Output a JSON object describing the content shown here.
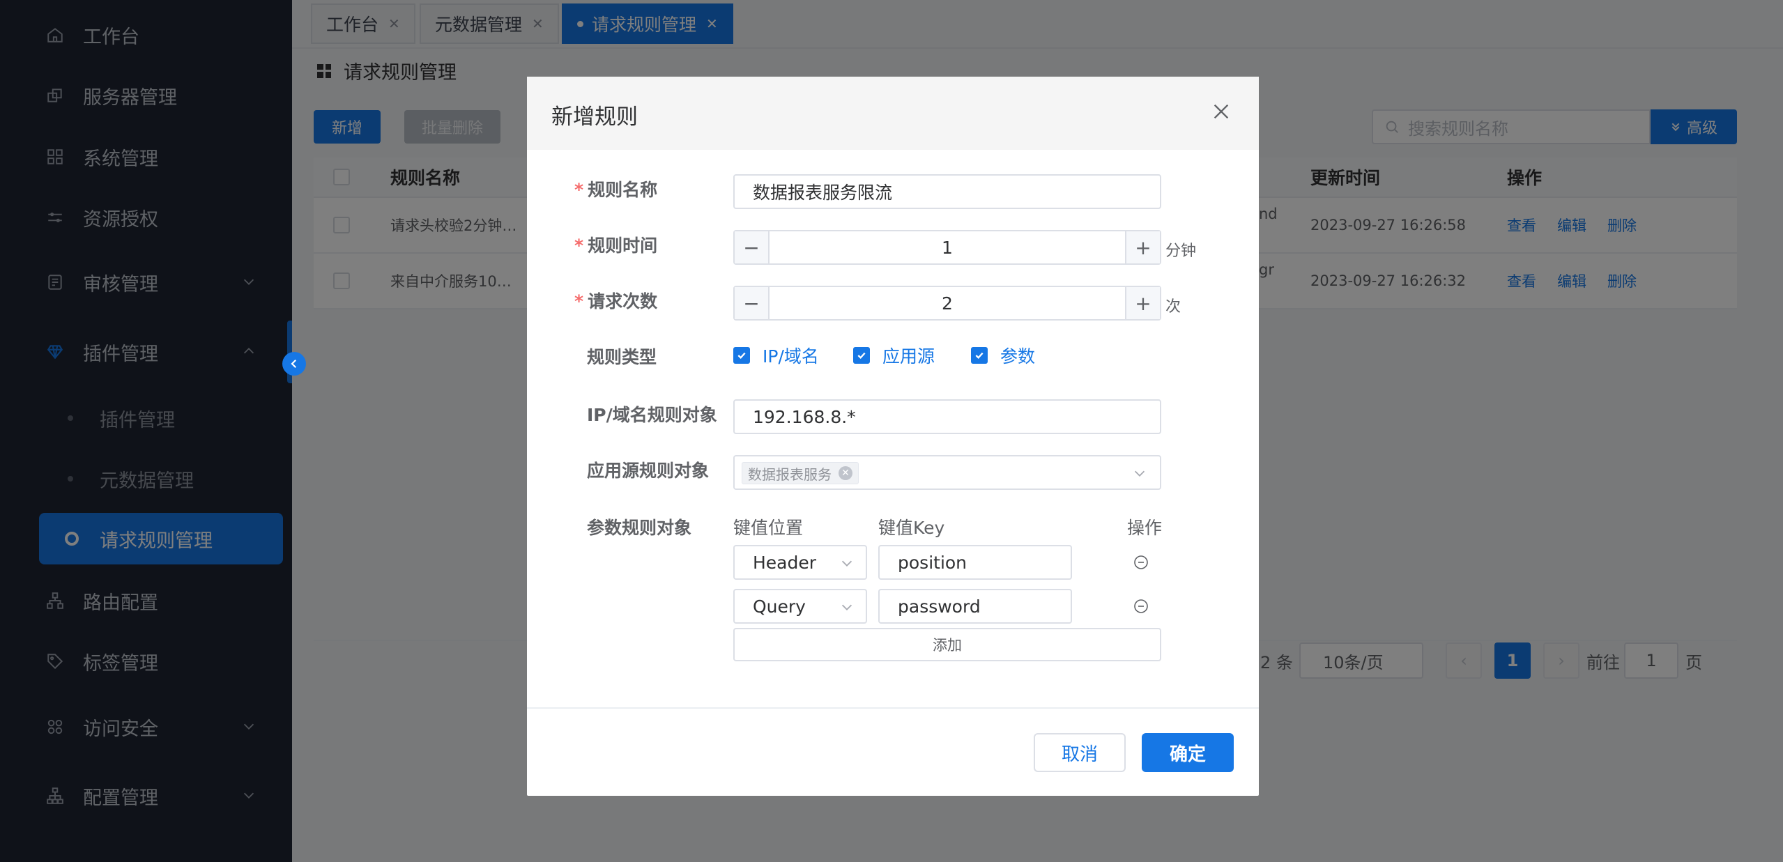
{
  "sidebar": {
    "items": [
      {
        "label": "工作台",
        "icon": "home-icon"
      },
      {
        "label": "服务器管理",
        "icon": "server-icon"
      },
      {
        "label": "系统管理",
        "icon": "grid-icon"
      },
      {
        "label": "资源授权",
        "icon": "sliders-icon"
      },
      {
        "label": "审核管理",
        "icon": "audit-icon"
      },
      {
        "label": "插件管理",
        "icon": "gem-icon"
      },
      {
        "label": "插件管理"
      },
      {
        "label": "元数据管理"
      },
      {
        "label": "请求规则管理"
      },
      {
        "label": "路由配置",
        "icon": "route-icon"
      },
      {
        "label": "标签管理",
        "icon": "tag-icon"
      },
      {
        "label": "访问安全",
        "icon": "security-icon"
      },
      {
        "label": "配置管理",
        "icon": "config-icon"
      }
    ]
  },
  "tabs": [
    {
      "label": "工作台"
    },
    {
      "label": "元数据管理"
    },
    {
      "label": "请求规则管理"
    }
  ],
  "page": {
    "title": "请求规则管理",
    "add_label": "新增",
    "batch_delete_label": "批量删除",
    "search_placeholder": "搜索规则名称",
    "advanced_label": "高级"
  },
  "table": {
    "headers": {
      "name": "规则名称",
      "updated": "更新时间",
      "ops": "操作"
    },
    "rows": [
      {
        "name": "请求头校验2分钟…",
        "frag": "nd",
        "updated": "2023-09-27 16:26:58"
      },
      {
        "name": "来自中介服务10…",
        "frag": "gr",
        "updated": "2023-09-27 16:26:32"
      }
    ],
    "op_view": "查看",
    "op_edit": "编辑",
    "op_delete": "删除"
  },
  "pager": {
    "total_suffix": "2 条",
    "page_size": "10条/页",
    "current_page": "1",
    "goto_prefix": "前往",
    "goto_value": "1",
    "goto_suffix": "页"
  },
  "modal": {
    "title": "新增规则",
    "fields": {
      "name_label": "规则名称",
      "name_value": "数据报表服务限流",
      "time_label": "规则时间",
      "time_value": "1",
      "time_unit": "分钟",
      "count_label": "请求次数",
      "count_value": "2",
      "count_unit": "次",
      "type_label": "规则类型",
      "type_options": [
        "IP/域名",
        "应用源",
        "参数"
      ],
      "ip_label": "IP/域名规则对象",
      "ip_value": "192.168.8.*",
      "app_label": "应用源规则对象",
      "app_tag": "数据报表服务",
      "param_label": "参数规则对象",
      "param_headers": {
        "position": "键值位置",
        "key": "键值Key",
        "ops": "操作"
      },
      "params": [
        {
          "position": "Header",
          "key": "position"
        },
        {
          "position": "Query",
          "key": "password"
        }
      ],
      "add_label": "添加"
    },
    "cancel_label": "取消",
    "ok_label": "确定"
  },
  "colors": {
    "primary": "#1677e5",
    "sidebar_bg": "#1e2433",
    "required": "#f56c6c"
  }
}
